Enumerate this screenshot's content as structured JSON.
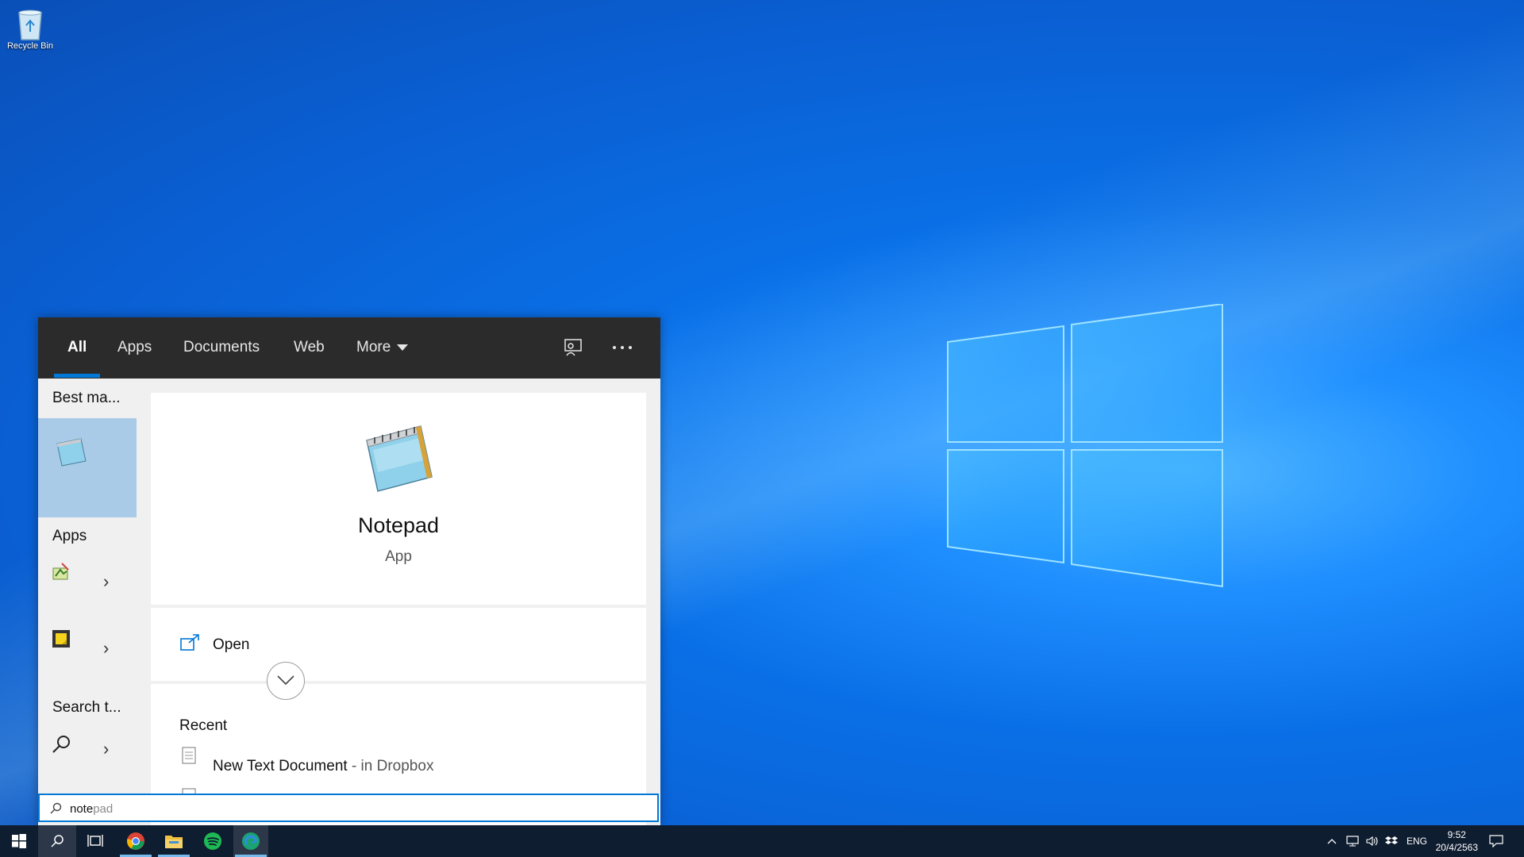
{
  "desktop": {
    "recycle_bin_label": "Recycle Bin"
  },
  "search": {
    "tabs": [
      "All",
      "Apps",
      "Documents",
      "Web",
      "More"
    ],
    "left": {
      "best_match": "Best ma...",
      "apps": "Apps",
      "search_web": "Search t..."
    },
    "result": {
      "name": "Notepad",
      "type": "App",
      "open_label": "Open",
      "recent_title": "Recent",
      "recent_item_name": "New Text Document",
      "recent_item_location": " - in Dropbox"
    },
    "query_typed": "note",
    "query_suggestion": "pad"
  },
  "taskbar": {
    "language": "ENG",
    "time": "9:52",
    "date": "20/4/2563"
  },
  "colors": {
    "accent": "#0078d7",
    "taskbar": "#0f1d30",
    "selected_tile": "#a9cbe8"
  }
}
